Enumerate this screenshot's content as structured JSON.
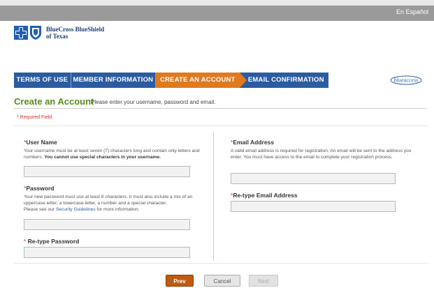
{
  "topbar": {
    "lang_link": "En Español"
  },
  "brand": {
    "line1": "BlueCross BlueShield",
    "line2": "of Texas"
  },
  "steps": [
    {
      "label": "TERMS OF USE"
    },
    {
      "label": "MEMBER INFORMATION"
    },
    {
      "label": "CREATE AN ACCOUNT"
    },
    {
      "label": "EMAIL CONFIRMATION"
    }
  ],
  "partner_logo": {
    "text": "blueaccess"
  },
  "page": {
    "title": "Create an Account",
    "subtitle": "Please enter your username, password and email.",
    "required_note": "* Required Field"
  },
  "form": {
    "username": {
      "label": "User Name",
      "help_plain": "Your username must be at least seven (7) characters long and contain only letters and numbers.",
      "help_bold": "You cannot use special characters in your username.",
      "value": ""
    },
    "password": {
      "label": "Password",
      "help_plain": "Your new password must use at least 8 characters. It must also include a mix of an uppercase letter, a lowercase letter, a number and a special character.",
      "help_pre_link": "Please see our",
      "help_link": "Security Guidelines",
      "help_post_link": "for more information.",
      "value": ""
    },
    "retype_password": {
      "label": "Re-type Password",
      "value": ""
    },
    "email": {
      "label": "Email Address",
      "help": "A valid email address is required for registration. An email will be sent to the address you enter. You must have access to the email to complete your registration process.",
      "value": ""
    },
    "retype_email": {
      "label": "Re-type Email Address",
      "value": ""
    }
  },
  "buttons": {
    "prev": "Prev",
    "cancel": "Cancel",
    "next": "Next"
  },
  "colors": {
    "nav_blue": "#2b5c9f",
    "active_orange": "#e07a1e",
    "title_green": "#5a8a1e",
    "required_red": "#d03030"
  }
}
